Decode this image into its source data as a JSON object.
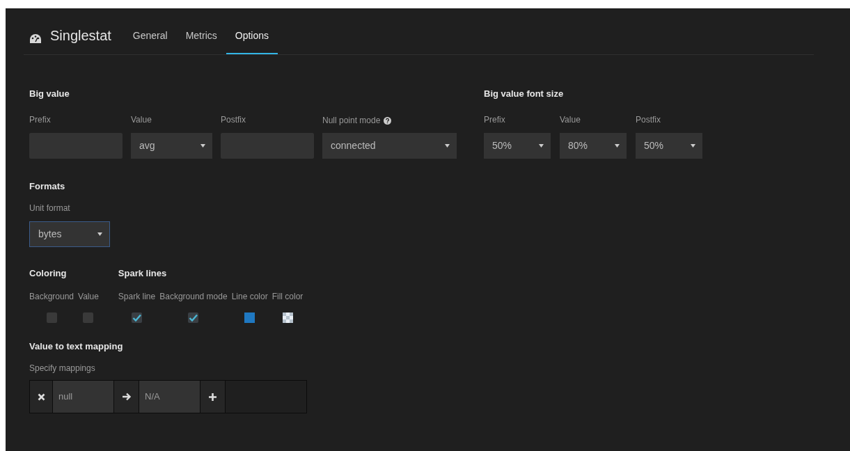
{
  "header": {
    "title": "Singlestat",
    "tabs": [
      {
        "label": "General",
        "selected": false
      },
      {
        "label": "Metrics",
        "selected": false
      },
      {
        "label": "Options",
        "selected": true
      }
    ]
  },
  "big_value": {
    "title": "Big value",
    "fields": [
      {
        "label": "Prefix",
        "kind": "input"
      },
      {
        "label": "Value",
        "kind": "select",
        "value": "avg"
      },
      {
        "label": "Postfix",
        "kind": "input"
      },
      {
        "label": "Null point mode",
        "kind": "select",
        "value": "connected",
        "help": true
      }
    ]
  },
  "big_value_font_size": {
    "title": "Big value font size",
    "fields": [
      {
        "label": "Prefix",
        "value": "50%"
      },
      {
        "label": "Value",
        "value": "80%"
      },
      {
        "label": "Postfix",
        "value": "50%"
      }
    ]
  },
  "formats": {
    "title": "Formats",
    "unit_format": {
      "label": "Unit format",
      "value": "bytes",
      "focused": true
    }
  },
  "coloring": {
    "title": "Coloring",
    "options": [
      {
        "label": "Background",
        "kind": "checkbox",
        "checked": false
      },
      {
        "label": "Value",
        "kind": "checkbox",
        "checked": false
      }
    ]
  },
  "spark_lines": {
    "title": "Spark lines",
    "options": [
      {
        "label": "Spark line",
        "kind": "checkbox",
        "checked": true
      },
      {
        "label": "Background mode",
        "kind": "checkbox",
        "checked": true
      },
      {
        "label": "Line color",
        "kind": "color",
        "color": "#1f78c1"
      },
      {
        "label": "Fill color",
        "kind": "checker"
      }
    ]
  },
  "mapping": {
    "title": "Value to text mapping",
    "label": "Specify mappings",
    "from": "null",
    "to": "N/A"
  }
}
